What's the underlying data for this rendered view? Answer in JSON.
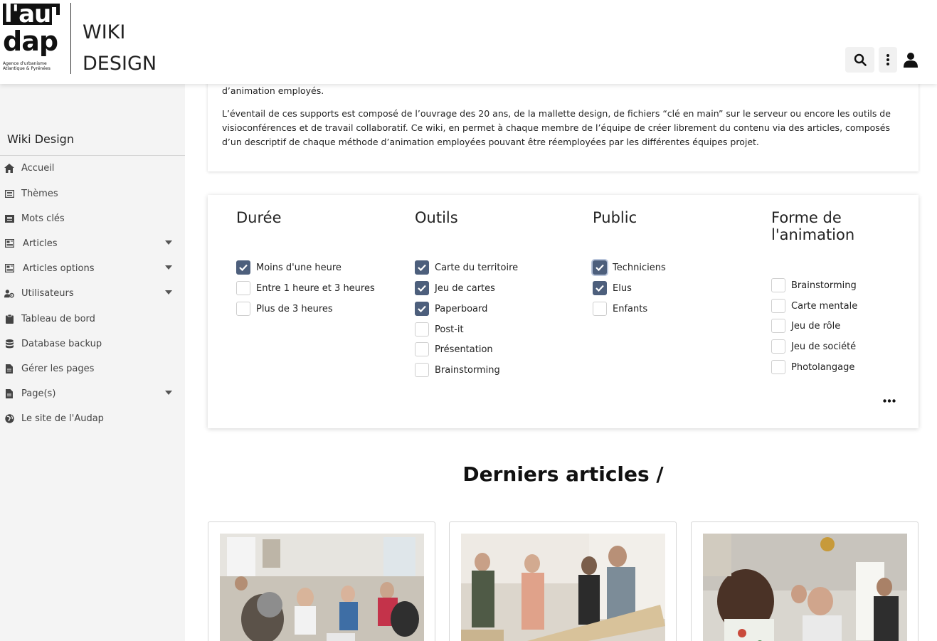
{
  "header": {
    "logo_line1": "l'au",
    "logo_line2": "dap",
    "logo_tagline1": "Agence d'urbanisme",
    "logo_tagline2": "Atlantique & Pyrénées",
    "title_line1": "WIKI",
    "title_line2": "DESIGN",
    "icons": [
      "search-icon",
      "more-vertical-icon",
      "user-icon"
    ]
  },
  "sidebar": {
    "title": "Wiki Design",
    "items": [
      {
        "label": "Accueil",
        "icon": "home-icon",
        "has_caret": false
      },
      {
        "label": "Thèmes",
        "icon": "list-icon",
        "has_caret": false
      },
      {
        "label": "Mots clés",
        "icon": "list-icon",
        "has_caret": false
      },
      {
        "label": "Articles",
        "icon": "newspaper-icon",
        "has_caret": true
      },
      {
        "label": "Articles options",
        "icon": "newspaper-icon",
        "has_caret": true
      },
      {
        "label": "Utilisateurs",
        "icon": "users-cog-icon",
        "has_caret": true
      },
      {
        "label": "Tableau de bord",
        "icon": "clipboard-icon",
        "has_caret": false
      },
      {
        "label": "Database backup",
        "icon": "database-icon",
        "has_caret": false
      },
      {
        "label": "Gérer les pages",
        "icon": "file-icon",
        "has_caret": false
      },
      {
        "label": "Page(s)",
        "icon": "file-icon",
        "has_caret": true
      },
      {
        "label": "Le site de l'Audap",
        "icon": "globe-icon",
        "has_caret": false
      }
    ]
  },
  "intro": {
    "para1": "d’animation employés.",
    "para2": "L’éventail de ces supports est composé de l’ouvrage des 20 ans, de la mallette design, de fichiers “clé en main” sur le serveur ou encore les outils de visioconférences et de travail collaboratif. Ce wiki, en permet à chaque membre de l’équipe de créer librement du contenu via des articles, composés d’un descriptif de chaque méthode d’animation employées pouvant être réemployées par les différentes équipes projet."
  },
  "filters": {
    "duree": {
      "title": "Durée",
      "options": [
        {
          "label": "Moins d'une heure",
          "checked": true
        },
        {
          "label": "Entre 1 heure et 3 heures",
          "checked": false
        },
        {
          "label": "Plus de 3 heures",
          "checked": false
        }
      ]
    },
    "outils": {
      "title": "Outils",
      "options": [
        {
          "label": "Carte du territoire",
          "checked": true
        },
        {
          "label": "Jeu de cartes",
          "checked": true
        },
        {
          "label": "Paperboard",
          "checked": true
        },
        {
          "label": "Post-it",
          "checked": false
        },
        {
          "label": "Présentation",
          "checked": false
        },
        {
          "label": "Brainstorming",
          "checked": false
        }
      ]
    },
    "public": {
      "title": "Public",
      "options": [
        {
          "label": "Techniciens",
          "checked": true
        },
        {
          "label": "Elus",
          "checked": true
        },
        {
          "label": "Enfants",
          "checked": false
        }
      ]
    },
    "forme": {
      "title": "Forme de l'animation",
      "options": [
        {
          "label": "Brainstorming",
          "checked": false
        },
        {
          "label": "Carte mentale",
          "checked": false
        },
        {
          "label": "Jeu de rôle",
          "checked": false
        },
        {
          "label": "Jeu de société",
          "checked": false
        },
        {
          "label": "Photolangage",
          "checked": false
        }
      ]
    },
    "more_icon": "more-horizontal-icon"
  },
  "latest": {
    "title": "Derniers articles /"
  },
  "colors": {
    "checkbox_checked": "#4d5f7c",
    "sidebar_bg": "#f4f4f4"
  }
}
